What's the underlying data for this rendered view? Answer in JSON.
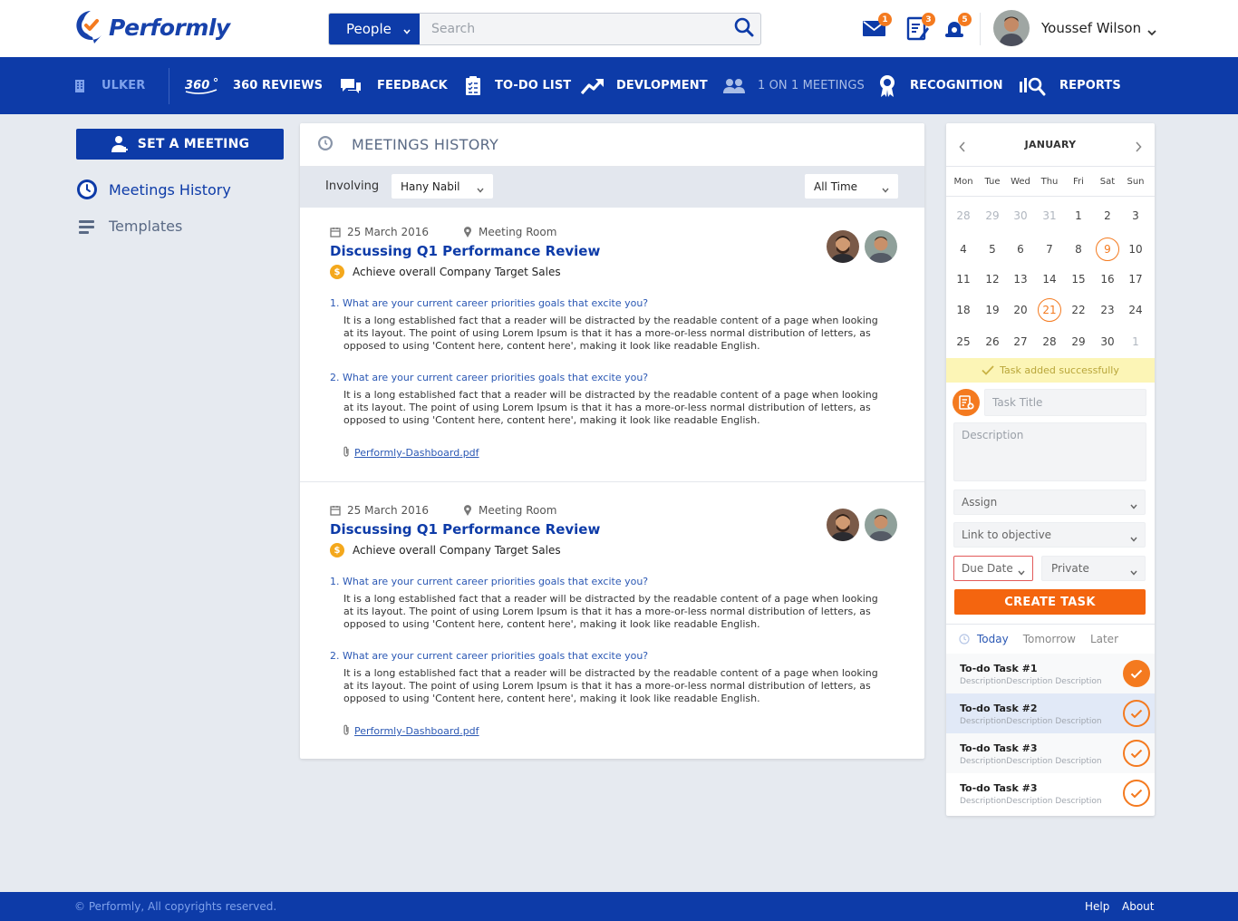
{
  "brand": {
    "name": "Performly"
  },
  "search": {
    "category": "People",
    "placeholder": "Search"
  },
  "header": {
    "badges": {
      "messages": "1",
      "tasks": "3",
      "notifications": "5"
    },
    "user_name": "Youssef Wilson"
  },
  "nav": {
    "company": "ULKER",
    "items": [
      {
        "label": "360 REVIEWS",
        "icon": "360-icon"
      },
      {
        "label": "FEEDBACK",
        "icon": "chat-icon"
      },
      {
        "label": "TO-DO LIST",
        "icon": "checklist-icon"
      },
      {
        "label": "DEVLOPMENT",
        "icon": "trend-up-icon"
      },
      {
        "label": "1 ON 1 MEETINGS",
        "icon": "people-icon"
      },
      {
        "label": "RECOGNITION",
        "icon": "award-icon"
      },
      {
        "label": "REPORTS",
        "icon": "report-search-icon"
      }
    ]
  },
  "sidebar": {
    "set_meeting": "SET A MEETING",
    "items": [
      {
        "label": "Meetings History",
        "active": true
      },
      {
        "label": "Templates",
        "active": false
      }
    ]
  },
  "main": {
    "title": "MEETINGS HISTORY",
    "filter": {
      "label": "Involving",
      "person": "Hany Nabil",
      "period": "All Time"
    },
    "meetings": [
      {
        "date": "25 March 2016",
        "location": "Meeting Room",
        "title": "Discussing Q1 Performance Review",
        "objective": "Achieve overall Company Target Sales",
        "qa": [
          {
            "q": "1. What are your current career priorities goals that excite you?",
            "a": "It is a long established fact that a reader will be distracted by the readable content of a page when looking at its layout. The point of using Lorem Ipsum is that it has a more-or-less normal distribution of letters, as opposed to using 'Content here, content here', making it look like readable English."
          },
          {
            "q": "2. What are your current career priorities goals that excite you?",
            "a": "It is a long established fact that a reader will be distracted by the readable content of a page when looking at its layout. The point of using Lorem Ipsum is that it has a more-or-less normal distribution of letters, as opposed to using 'Content here, content here', making it look like readable English."
          }
        ],
        "attachment": "Performly-Dashboard.pdf"
      },
      {
        "date": "25 March 2016",
        "location": "Meeting Room",
        "title": "Discussing Q1 Performance Review",
        "objective": "Achieve overall Company Target Sales",
        "qa": [
          {
            "q": "1. What are your current career priorities goals that excite you?",
            "a": "It is a long established fact that a reader will be distracted by the readable content of a page when looking at its layout. The point of using Lorem Ipsum is that it has a more-or-less normal distribution of letters, as opposed to using 'Content here, content here', making it look like readable English."
          },
          {
            "q": "2. What are your current career priorities goals that excite you?",
            "a": "It is a long established fact that a reader will be distracted by the readable content of a page when looking at its layout. The point of using Lorem Ipsum is that it has a more-or-less normal distribution of letters, as opposed to using 'Content here, content here', making it look like readable English."
          }
        ],
        "attachment": "Performly-Dashboard.pdf"
      }
    ]
  },
  "calendar": {
    "month": "JANUARY",
    "weekdays": [
      "Mon",
      "Tue",
      "Wed",
      "Thu",
      "Fri",
      "Sat",
      "Sun"
    ],
    "weeks": [
      [
        "28",
        "29",
        "30",
        "31",
        "1",
        "2",
        "3"
      ],
      [
        "4",
        "5",
        "6",
        "7",
        "8",
        "9",
        "10"
      ],
      [
        "11",
        "12",
        "13",
        "14",
        "15",
        "16",
        "17"
      ],
      [
        "18",
        "19",
        "20",
        "21",
        "22",
        "23",
        "24"
      ],
      [
        "25",
        "26",
        "27",
        "28",
        "29",
        "30",
        "1"
      ]
    ],
    "circled_days": [
      "9",
      "21"
    ]
  },
  "task_form": {
    "toast": "Task added successfully",
    "title_placeholder": "Task Title",
    "description_placeholder": "Description",
    "assign": "Assign",
    "objective": "Link to objective",
    "due_date": "Due Date",
    "privacy": "Private",
    "submit": "CREATE TASK"
  },
  "todo": {
    "tabs": [
      "Today",
      "Tomorrow",
      "Later"
    ],
    "active_tab": "Today",
    "items": [
      {
        "title": "To-do Task #1",
        "desc": "DescriptionDescription Description",
        "done": true
      },
      {
        "title": "To-do Task #2",
        "desc": "DescriptionDescription Description",
        "done": false
      },
      {
        "title": "To-do Task #3",
        "desc": "DescriptionDescription Description",
        "done": false
      },
      {
        "title": "To-do Task #3",
        "desc": "DescriptionDescription Description",
        "done": false
      }
    ]
  },
  "footer": {
    "copyright": "© Performly, All copyrights reserved.",
    "help": "Help",
    "about": "About"
  },
  "colors": {
    "primary": "#0d3ba8",
    "accent": "#f47a1f",
    "background": "#e6eaf0"
  }
}
